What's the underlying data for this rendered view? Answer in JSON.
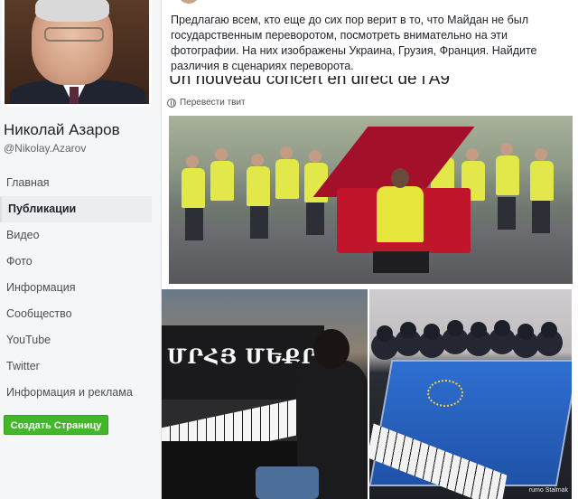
{
  "profile": {
    "name": "Николай Азаров",
    "handle": "@Nikolay.Azarov"
  },
  "nav": {
    "items": [
      {
        "label": "Главная",
        "active": false
      },
      {
        "label": "Публикации",
        "active": true
      },
      {
        "label": "Видео",
        "active": false
      },
      {
        "label": "Фото",
        "active": false
      },
      {
        "label": "Информация",
        "active": false
      },
      {
        "label": "Сообщество",
        "active": false
      },
      {
        "label": "YouTube",
        "active": false
      },
      {
        "label": "Twitter",
        "active": false
      },
      {
        "label": "Информация и реклама",
        "active": false
      }
    ]
  },
  "create_page_label": "Создать Страницу",
  "post": {
    "text": "Предлагаю всем, кто еще до сих пор верит в то, что Майдан не был государственным переворотом, посмотреть внимательно на эти фотографии. На них изображены Украина, Грузия, Франция. Найдите различия в сценариях переворота.",
    "banner_text": "Un nouveau concert en direct de l'A9",
    "translate_label": "Перевести твит",
    "photo_left_sign": "ՄՐՀՅ ՄԵՔՐԼ",
    "photo_credit": "rumo Stalmak"
  },
  "colors": {
    "create_button": "#42b72a",
    "vest": "#e2e84a",
    "piano_red": "#c0152a",
    "piano_blue": "#2e6fd1"
  }
}
